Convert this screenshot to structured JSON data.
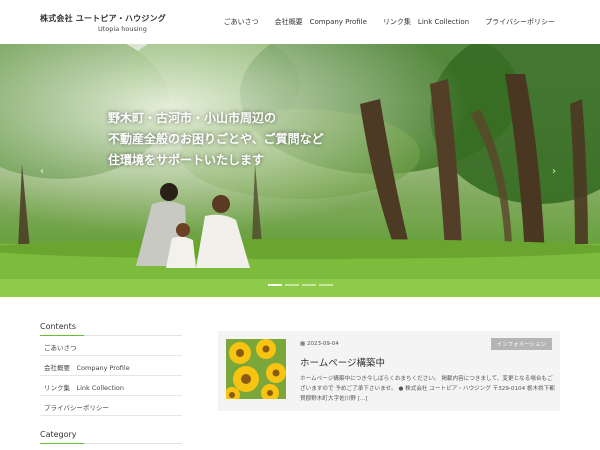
{
  "header": {
    "logo_main": "株式会社 ユートピア・ハウジング",
    "logo_sub": "Utopia housing",
    "nav": [
      {
        "label": "ごあいさつ"
      },
      {
        "label": "会社概要　Company Profile"
      },
      {
        "label": "リンク集　Link Collection"
      },
      {
        "label": "プライバシーポリシー"
      }
    ]
  },
  "hero": {
    "lines": [
      "野木町・古河市・小山市周辺の",
      "不動産全般のお困りごとや、ご質問など",
      "住環境をサポートいたします"
    ],
    "prev_icon": "‹",
    "next_icon": "›",
    "slide_count": 4,
    "active_slide": 1
  },
  "sidebar": {
    "contents_heading": "Contents",
    "items": [
      {
        "label": "ごあいさつ"
      },
      {
        "label": "会社概要　Company Profile"
      },
      {
        "label": "リンク集　Link Collection"
      },
      {
        "label": "プライバシーポリシー"
      }
    ],
    "category_heading": "Category"
  },
  "post": {
    "date": "2023-09-04",
    "badge": "インフォメーション",
    "title": "ホームページ構築中",
    "excerpt": "ホームページ構築中につき今しばらくおまちください。 掲載内容につきまして、変更となる場合もございますので 予めご了承下さいませ。 ● 株式会社 ユートピア・ハウジング 〒329-0104 栃木県下都賀郡野木町大字佐川野 [...]"
  },
  "colors": {
    "accent_green": "#6cba3a",
    "badge_gray": "#b5b5b5",
    "card_bg": "#f4f4f4"
  }
}
